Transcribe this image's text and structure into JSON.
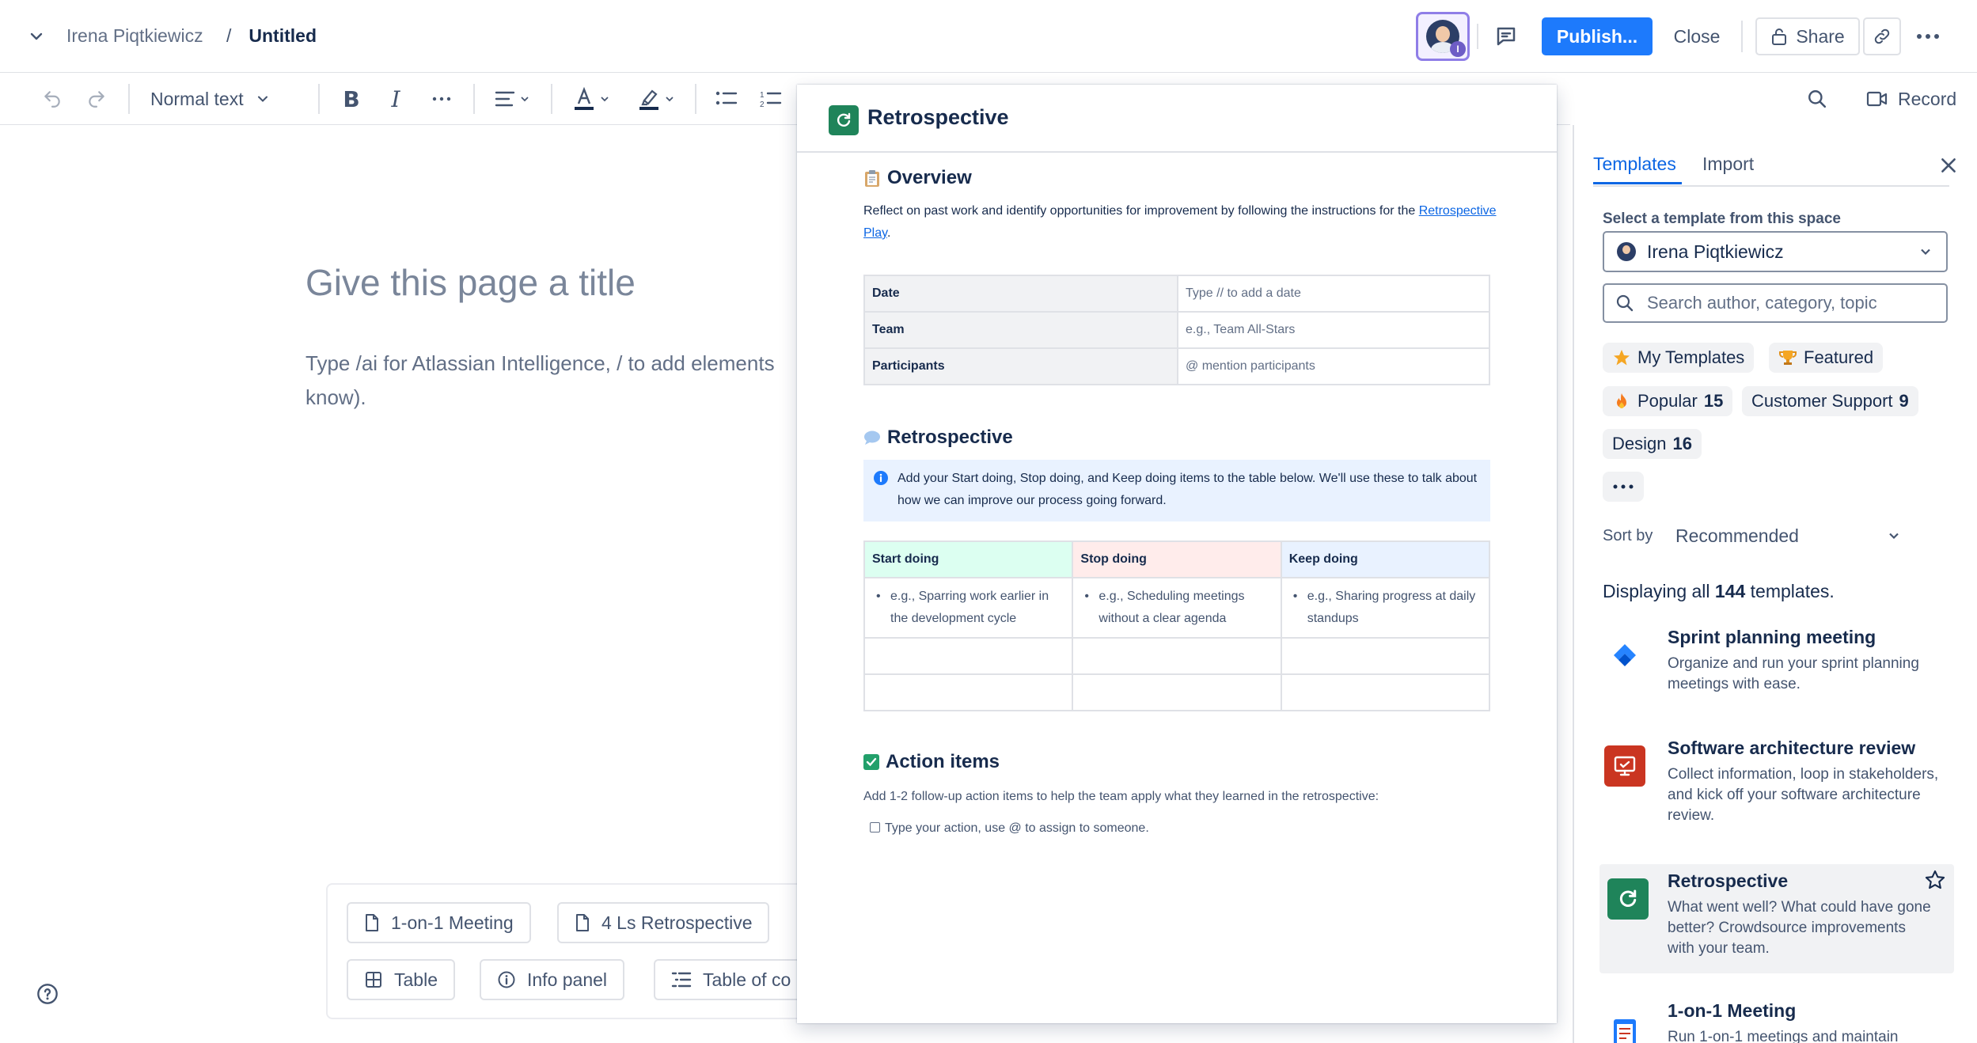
{
  "header": {
    "breadcrumb_owner": "Irena Piqtkiewicz",
    "breadcrumb_sep": "/",
    "page_name": "Untitled",
    "publish_label": "Publish...",
    "close_label": "Close",
    "share_label": "Share"
  },
  "toolbar": {
    "text_style": "Normal text",
    "record_label": "Record"
  },
  "editor": {
    "title_placeholder": "Give this page a title",
    "body_placeholder": "Type /ai for Atlassian Intelligence, / to add elements",
    "body_placeholder_2": "know)."
  },
  "suggestions": {
    "row1": [
      "1-on-1 Meeting",
      "4 Ls Retrospective"
    ],
    "row2": [
      "Table",
      "Info panel",
      "Table of co"
    ]
  },
  "preview": {
    "title": "Retrospective",
    "overview_heading": "Overview",
    "overview_text": "Reflect on past work and identify opportunities for improvement by following the instructions for the",
    "overview_link": "Retrospective Play",
    "overview_after_link": ".",
    "details": [
      {
        "label": "Date",
        "placeholder": "Type // to add a date"
      },
      {
        "label": "Team",
        "placeholder": "e.g., Team All-Stars"
      },
      {
        "label": "Participants",
        "placeholder": "@ mention participants"
      }
    ],
    "retro_heading": "Retrospective",
    "info_text": "Add your Start doing, Stop doing, and Keep doing items to the table below. We'll use these to talk about how we can improve our process going forward.",
    "retro_columns": [
      {
        "label": "Start doing",
        "example": "e.g., Sparring work earlier in the development cycle",
        "color": "#dcfff1"
      },
      {
        "label": "Stop doing",
        "example": "e.g., Scheduling meetings without a clear agenda",
        "color": "#ffeceb"
      },
      {
        "label": "Keep doing",
        "example": "e.g., Sharing progress at daily standups",
        "color": "#e9f2ff"
      }
    ],
    "action_heading": "Action items",
    "action_text": "Add 1-2 follow-up action items to help the team apply what they learned in the retrospective:",
    "action_item": "Type your action, use @ to assign to someone."
  },
  "sidebar": {
    "tabs": [
      "Templates",
      "Import"
    ],
    "space_label": "Select a template from this space",
    "space_value": "Irena Piqtkiewicz",
    "search_placeholder": "Search author, category, topic",
    "filters": [
      {
        "label": "My Templates",
        "count": ""
      },
      {
        "label": "Featured",
        "count": ""
      },
      {
        "label": "Popular",
        "count": "15"
      },
      {
        "label": "Customer Support",
        "count": "9"
      },
      {
        "label": "Design",
        "count": "16"
      }
    ],
    "sort_label": "Sort by",
    "sort_value": "Recommended",
    "displaying_prefix": "Displaying all ",
    "displaying_count": "144",
    "displaying_suffix": " templates.",
    "templates": [
      {
        "name": "Sprint planning meeting",
        "desc": "Organize and run your sprint planning meetings with ease."
      },
      {
        "name": "Software architecture review",
        "desc": "Collect information, loop in stakeholders, and kick off your software architecture review."
      },
      {
        "name": "Retrospective",
        "desc": "What went well? What could have gone better? Crowdsource improvements with your team."
      },
      {
        "name": "1-on-1 Meeting",
        "desc": "Run 1-on-1 meetings and maintain"
      }
    ]
  },
  "colors": {
    "accent": "#0c66e4",
    "publish_bg": "#1d7afc",
    "retro_green": "#1f845a",
    "arch_red": "#ca3521"
  }
}
